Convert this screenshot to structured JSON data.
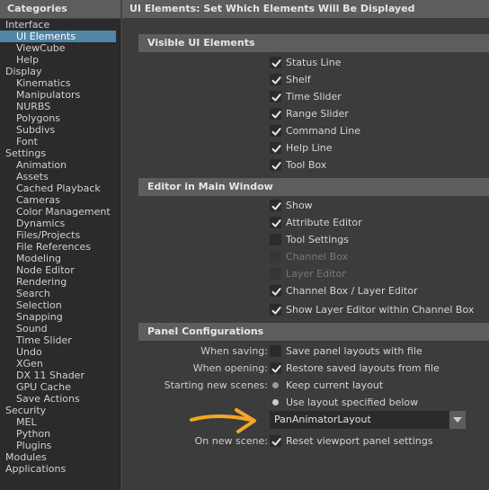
{
  "left": {
    "header": "Categories",
    "items": [
      {
        "label": "Interface",
        "level": 0
      },
      {
        "label": "UI Elements",
        "level": 1,
        "selected": true
      },
      {
        "label": "ViewCube",
        "level": 1
      },
      {
        "label": "Help",
        "level": 1
      },
      {
        "label": "Display",
        "level": 0
      },
      {
        "label": "Kinematics",
        "level": 1
      },
      {
        "label": "Manipulators",
        "level": 1
      },
      {
        "label": "NURBS",
        "level": 1
      },
      {
        "label": "Polygons",
        "level": 1
      },
      {
        "label": "Subdivs",
        "level": 1
      },
      {
        "label": "Font",
        "level": 1
      },
      {
        "label": "Settings",
        "level": 0
      },
      {
        "label": "Animation",
        "level": 1
      },
      {
        "label": "Assets",
        "level": 1
      },
      {
        "label": "Cached Playback",
        "level": 1
      },
      {
        "label": "Cameras",
        "level": 1
      },
      {
        "label": "Color Management",
        "level": 1
      },
      {
        "label": "Dynamics",
        "level": 1
      },
      {
        "label": "Files/Projects",
        "level": 1
      },
      {
        "label": "File References",
        "level": 1
      },
      {
        "label": "Modeling",
        "level": 1
      },
      {
        "label": "Node Editor",
        "level": 1
      },
      {
        "label": "Rendering",
        "level": 1
      },
      {
        "label": "Search",
        "level": 1
      },
      {
        "label": "Selection",
        "level": 1
      },
      {
        "label": "Snapping",
        "level": 1
      },
      {
        "label": "Sound",
        "level": 1
      },
      {
        "label": "Time Slider",
        "level": 1
      },
      {
        "label": "Undo",
        "level": 1
      },
      {
        "label": "XGen",
        "level": 1
      },
      {
        "label": "DX 11 Shader",
        "level": 1
      },
      {
        "label": "GPU Cache",
        "level": 1
      },
      {
        "label": "Save Actions",
        "level": 1
      },
      {
        "label": "Security",
        "level": 0
      },
      {
        "label": "MEL",
        "level": 1
      },
      {
        "label": "Python",
        "level": 1
      },
      {
        "label": "Plugins",
        "level": 1
      },
      {
        "label": "Modules",
        "level": 0
      },
      {
        "label": "Applications",
        "level": 0
      }
    ]
  },
  "right": {
    "header": "UI Elements: Set Which Elements Will Be Displayed",
    "sections": {
      "visible_ui": {
        "title": "Visible UI Elements",
        "items": [
          {
            "label": "Status Line",
            "checked": true
          },
          {
            "label": "Shelf",
            "checked": true
          },
          {
            "label": "Time Slider",
            "checked": true
          },
          {
            "label": "Range Slider",
            "checked": true
          },
          {
            "label": "Command Line",
            "checked": true
          },
          {
            "label": "Help Line",
            "checked": true
          },
          {
            "label": "Tool Box",
            "checked": true
          }
        ]
      },
      "editor_main": {
        "title": "Editor in Main Window",
        "items": [
          {
            "label": "Show",
            "checked": true,
            "enabled": true
          },
          {
            "label": "Attribute Editor",
            "checked": true,
            "enabled": true
          },
          {
            "label": "Tool Settings",
            "checked": false,
            "enabled": true
          },
          {
            "label": "Channel Box",
            "checked": false,
            "enabled": false
          },
          {
            "label": "Layer Editor",
            "checked": false,
            "enabled": false
          },
          {
            "label": "Channel Box / Layer Editor",
            "checked": true,
            "enabled": true
          },
          {
            "label": "Show Layer Editor within Channel Box",
            "checked": true,
            "enabled": true
          }
        ]
      },
      "panel_config": {
        "title": "Panel Configurations",
        "when_saving": {
          "label": "When saving:",
          "option": "Save panel layouts with file",
          "checked": false
        },
        "when_opening": {
          "label": "When opening:",
          "option": "Restore saved layouts from file",
          "checked": true
        },
        "starting_new": {
          "label": "Starting new scenes:",
          "option_keep": "Keep current layout",
          "option_use": "Use layout specified below",
          "selected": "use"
        },
        "layout_dropdown": {
          "value": "PanAnimatorLayout"
        },
        "on_new_scene": {
          "label": "On new scene:",
          "option": "Reset viewport panel settings",
          "checked": true
        }
      }
    }
  },
  "colors": {
    "selection": "#5285a6",
    "annotation_arrow": "#f5a623"
  }
}
